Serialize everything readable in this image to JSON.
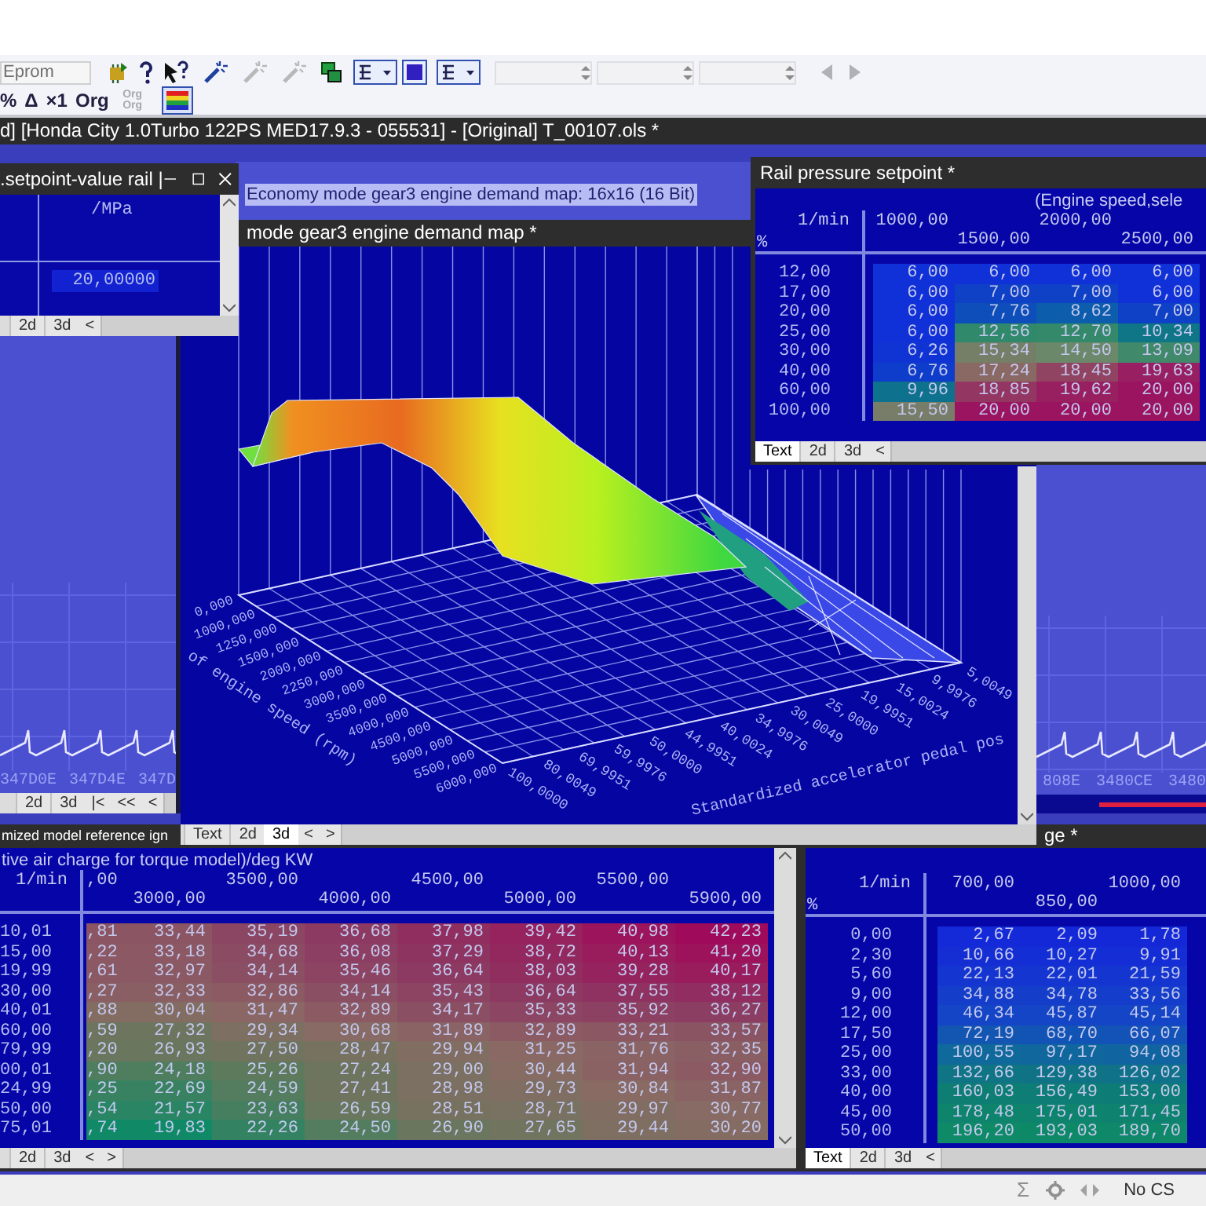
{
  "toolbar": {
    "file_field": "Eprom",
    "tools": [
      {
        "kind": "chip",
        "disabled": false
      },
      {
        "kind": "help",
        "disabled": false
      },
      {
        "kind": "pointer-help",
        "disabled": false
      },
      {
        "kind": "wand",
        "disabled": false
      },
      {
        "kind": "wand",
        "disabled": true
      },
      {
        "kind": "wand",
        "disabled": true
      },
      {
        "kind": "windows",
        "disabled": false
      },
      {
        "kind": "layout-dropdown",
        "disabled": false
      },
      {
        "kind": "color-square",
        "disabled": false
      },
      {
        "kind": "layout-dropdown",
        "disabled": false
      }
    ],
    "nav": [
      {
        "kind": "arrow-left",
        "disabled": true
      },
      {
        "kind": "arrow-right",
        "disabled": true
      }
    ],
    "mode_buttons": [
      {
        "label": "%",
        "disabled": false
      },
      {
        "label": "Δ",
        "disabled": false
      },
      {
        "label": "×1",
        "disabled": false
      },
      {
        "label": "Org",
        "disabled": false
      },
      {
        "label": "Org Org",
        "disabled": true
      }
    ],
    "color_scale": {
      "selected": true
    }
  },
  "title": "d] [Honda City 1.0Turbo 122PS MED17.9.3 - 055531] - [Original] T_00107.ols *",
  "hex_left_window": {
    "addresses": [
      "347D0E",
      "347D4E",
      "347D"
    ],
    "tabs": [
      {
        "label": "2d",
        "selected": false
      },
      {
        "label": "3d",
        "selected": false
      }
    ],
    "nav": [
      "|<",
      "<<",
      "<"
    ]
  },
  "hex_right_window": {
    "addresses": [
      "808E",
      "3480CE",
      "3480"
    ]
  },
  "background_map_window": {
    "title": "Economy mode gear3 engine demand map: 16x16 (16 Bit)"
  },
  "ignition_window": {
    "title": "mized model reference ign",
    "axis_note": "tive air charge for torque model)/deg KW",
    "unit": "1/min",
    "columns": [
      ",00",
      "3000,00",
      "3500,00",
      "4000,00",
      "4500,00",
      "5000,00",
      "5500,00",
      "5900,00"
    ],
    "rows": [
      {
        "label": "10,01",
        "values": [
          ",81",
          "33,44",
          "35,19",
          "36,68",
          "37,98",
          "39,42",
          "40,98",
          "42,23"
        ]
      },
      {
        "label": "15,00",
        "values": [
          ",22",
          "33,18",
          "34,68",
          "36,08",
          "37,29",
          "38,72",
          "40,13",
          "41,20"
        ]
      },
      {
        "label": "19,99",
        "values": [
          ",61",
          "32,97",
          "34,14",
          "35,46",
          "36,64",
          "38,03",
          "39,28",
          "40,17"
        ]
      },
      {
        "label": "30,00",
        "values": [
          ",27",
          "32,33",
          "32,86",
          "34,14",
          "35,43",
          "36,64",
          "37,55",
          "38,12"
        ]
      },
      {
        "label": "40,01",
        "values": [
          ",88",
          "30,04",
          "31,47",
          "32,89",
          "34,17",
          "35,33",
          "35,92",
          "36,27"
        ]
      },
      {
        "label": "60,00",
        "values": [
          ",59",
          "27,32",
          "29,34",
          "30,68",
          "31,89",
          "32,89",
          "33,21",
          "33,57"
        ]
      },
      {
        "label": "79,99",
        "values": [
          ",20",
          "26,93",
          "27,50",
          "28,47",
          "29,94",
          "31,25",
          "31,76",
          "32,35"
        ]
      },
      {
        "label": "00,01",
        "values": [
          ",90",
          "24,18",
          "25,26",
          "27,24",
          "29,00",
          "30,44",
          "31,94",
          "32,90"
        ]
      },
      {
        "label": "24,99",
        "values": [
          ",25",
          "22,69",
          "24,59",
          "27,41",
          "28,98",
          "29,73",
          "30,84",
          "31,87"
        ]
      },
      {
        "label": "50,00",
        "values": [
          ",54",
          "21,57",
          "23,63",
          "26,59",
          "28,51",
          "28,71",
          "29,97",
          "30,77"
        ]
      },
      {
        "label": "75,01",
        "values": [
          ",74",
          "19,83",
          "22,26",
          "24,50",
          "26,90",
          "27,65",
          "29,44",
          "30,20"
        ]
      }
    ],
    "tabs": [
      {
        "label": "2d",
        "selected": false
      },
      {
        "label": "3d",
        "selected": false
      }
    ],
    "nav": [
      "<",
      ">"
    ]
  },
  "charge_window": {
    "title": "ge *",
    "unit": "1/min",
    "percent": "%",
    "columns": [
      "700,00",
      "850,00",
      "1000,00"
    ],
    "rows": [
      {
        "label": "0,00",
        "values": [
          "2,67",
          "2,09",
          "1,78"
        ]
      },
      {
        "label": "2,30",
        "values": [
          "10,66",
          "10,27",
          "9,91"
        ]
      },
      {
        "label": "5,60",
        "values": [
          "22,13",
          "22,01",
          "21,59"
        ]
      },
      {
        "label": "9,00",
        "values": [
          "34,88",
          "34,78",
          "33,56"
        ]
      },
      {
        "label": "12,00",
        "values": [
          "46,34",
          "45,87",
          "45,14"
        ]
      },
      {
        "label": "17,50",
        "values": [
          "72,19",
          "68,70",
          "66,07"
        ]
      },
      {
        "label": "25,00",
        "values": [
          "100,55",
          "97,17",
          "94,08"
        ]
      },
      {
        "label": "33,00",
        "values": [
          "132,66",
          "129,38",
          "126,02"
        ]
      },
      {
        "label": "40,00",
        "values": [
          "160,03",
          "156,49",
          "153,00"
        ]
      },
      {
        "label": "45,00",
        "values": [
          "178,48",
          "175,01",
          "171,45"
        ]
      },
      {
        "label": "50,00",
        "values": [
          "196,20",
          "193,03",
          "189,70"
        ]
      }
    ],
    "tabs": [
      {
        "label": "Text",
        "selected": true
      },
      {
        "label": "2d",
        "selected": false
      },
      {
        "label": "3d",
        "selected": false
      }
    ],
    "nav": [
      "<"
    ]
  },
  "surface_window": {
    "title": "mode gear3 engine demand map *",
    "left_ticks": [
      "0,000",
      "1000,000",
      "1250,000",
      "1500,000",
      "2000,000",
      "2250,000",
      "3000,000",
      "3500,000",
      "4000,000",
      "4500,000",
      "5000,000",
      "5500,000",
      "6000,000"
    ],
    "left_axis_title": "of engine speed (rpm)",
    "right_ticks": [
      "100,0000",
      "80,0049",
      "69,9951",
      "59,9976",
      "50,0000",
      "44,9951",
      "40,0024",
      "34,9976",
      "30,0049",
      "25,0000",
      "19,9951",
      "15,0024",
      "9,9976",
      "5,0049"
    ],
    "right_axis_title": "Standardized accelerator pedal pos",
    "tabs": [
      {
        "label": "Text",
        "selected": false
      },
      {
        "label": "2d",
        "selected": false
      },
      {
        "label": "3d",
        "selected": true
      }
    ],
    "nav": [
      "<",
      ">"
    ]
  },
  "setpoint_window": {
    "title": ".setpoint-value rail |",
    "unit": "/MPa",
    "value": "20,00000",
    "tabs": [
      {
        "label": "2d",
        "selected": false
      },
      {
        "label": "3d",
        "selected": false
      }
    ],
    "nav": [
      "<"
    ]
  },
  "rail_window": {
    "title": "Rail pressure setpoint *",
    "axis_note": "(Engine speed,sele",
    "unit": "1/min",
    "percent": "%",
    "columns": [
      "1000,00",
      "1500,00",
      "2000,00",
      "2500,00"
    ],
    "rows": [
      {
        "label": "12,00",
        "values": [
          "6,00",
          "6,00",
          "6,00",
          "6,00"
        ]
      },
      {
        "label": "17,00",
        "values": [
          "6,00",
          "7,00",
          "7,00",
          "6,00"
        ]
      },
      {
        "label": "20,00",
        "values": [
          "6,00",
          "7,76",
          "8,62",
          "7,00"
        ]
      },
      {
        "label": "25,00",
        "values": [
          "6,00",
          "12,56",
          "12,70",
          "10,34"
        ]
      },
      {
        "label": "30,00",
        "values": [
          "6,26",
          "15,34",
          "14,50",
          "13,09"
        ]
      },
      {
        "label": "40,00",
        "values": [
          "6,76",
          "17,24",
          "18,45",
          "19,63"
        ]
      },
      {
        "label": "60,00",
        "values": [
          "9,96",
          "18,85",
          "19,62",
          "20,00"
        ]
      },
      {
        "label": "100,00",
        "values": [
          "15,50",
          "20,00",
          "20,00",
          "20,00"
        ]
      }
    ],
    "tabs": [
      {
        "label": "Text",
        "selected": true
      },
      {
        "label": "2d",
        "selected": false
      },
      {
        "label": "3d",
        "selected": false
      }
    ],
    "nav": [
      "<"
    ]
  },
  "status_bar": {
    "sum": "Σ",
    "label": "No CS"
  }
}
